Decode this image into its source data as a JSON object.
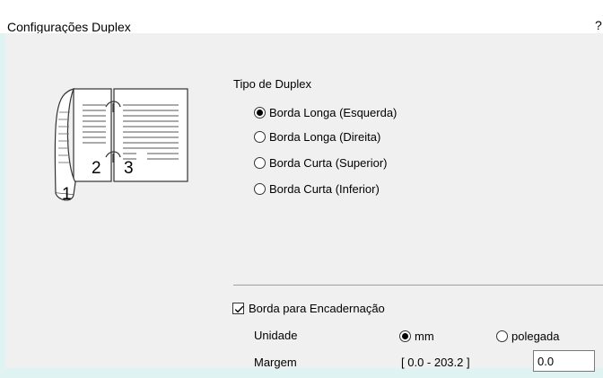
{
  "window": {
    "title": "Configurações Duplex",
    "help_glyph": "?"
  },
  "duplex": {
    "heading": "Tipo de Duplex",
    "options": [
      {
        "label": "Borda Longa (Esquerda)",
        "checked": true
      },
      {
        "label": "Borda Longa (Direita)",
        "checked": false
      },
      {
        "label": "Borda Curta (Superior)",
        "checked": false
      },
      {
        "label": "Borda Curta (Inferior)",
        "checked": false
      }
    ],
    "page_numbers": [
      "1",
      "2",
      "3"
    ]
  },
  "binding": {
    "checkbox_label": "Borda para Encadernação",
    "checked": true,
    "unit_label": "Unidade",
    "unit_options": [
      "mm",
      "polegada"
    ],
    "unit_selected": "mm",
    "margin_label": "Margem",
    "margin_range": "[ 0.0 - 203.2 ]",
    "margin_value": "0.0"
  }
}
